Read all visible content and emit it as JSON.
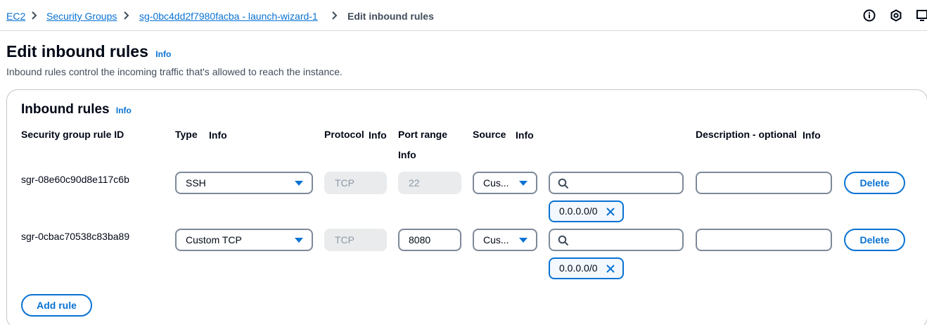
{
  "breadcrumb": {
    "items": [
      "EC2",
      "Security Groups",
      "sg-0bc4dd2f7980facba - launch-wizard-1"
    ],
    "current": "Edit inbound rules"
  },
  "header": {
    "title": "Edit inbound rules",
    "info": "Info",
    "description": "Inbound rules control the incoming traffic that's allowed to reach the instance."
  },
  "panel": {
    "title": "Inbound rules",
    "info": "Info",
    "columns": {
      "rule_id": "Security group rule ID",
      "type": "Type",
      "type_info": "Info",
      "protocol": "Protocol",
      "protocol_info": "Info",
      "port_range": "Port range",
      "port_info": "Info",
      "source": "Source",
      "source_info": "Info",
      "description": "Description - optional",
      "description_info": "Info"
    },
    "rows": [
      {
        "rule_id": "sgr-08e60c90d8e117c6b",
        "type": "SSH",
        "protocol": "TCP",
        "port": "22",
        "source": "Cus...",
        "search_value": "",
        "token": "0.0.0.0/0",
        "description": "",
        "delete": "Delete"
      },
      {
        "rule_id": "sgr-0cbac70538c83ba89",
        "type": "Custom TCP",
        "protocol": "TCP",
        "port": "8080",
        "source": "Cus...",
        "search_value": "",
        "token": "0.0.0.0/0",
        "description": "",
        "delete": "Delete"
      }
    ],
    "add_rule": "Add rule"
  },
  "colors": {
    "link": "#0972d3",
    "text": "#000716",
    "muted": "#414d5c",
    "border": "#7d8998"
  }
}
